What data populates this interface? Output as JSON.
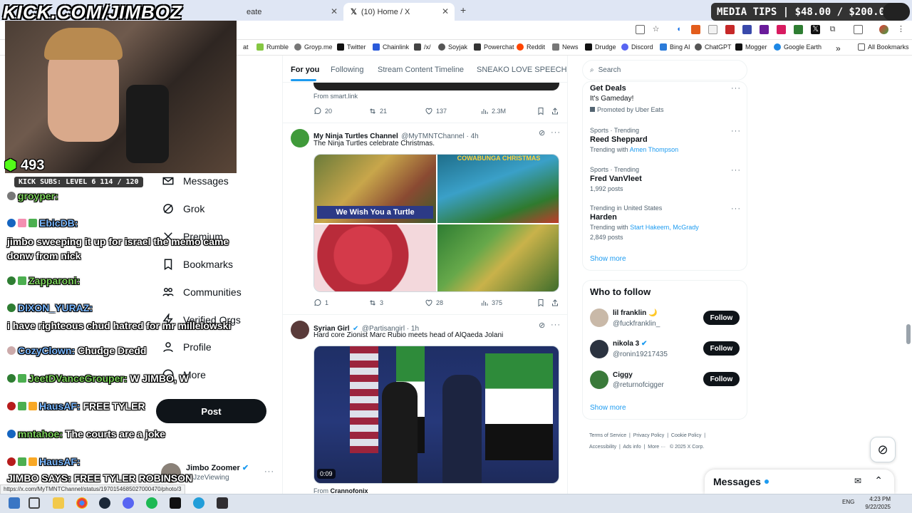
{
  "overlay": {
    "title_banner": "KICK.COM/JIMBOZ",
    "media_tips": "MEDIA TIPS | $48.00 / $200.00",
    "viewer_count": "493",
    "kick_subs": "KICK SUBS: LEVEL 6 114 / 120",
    "chat": [
      {
        "user": "groyper:",
        "msg": ""
      },
      {
        "user": "EbicDB:",
        "msg": "jimbo sweeping it up for israel the memo came donw from nick"
      },
      {
        "user": "Zapparoni:",
        "msg": ""
      },
      {
        "user": "DIXON_YURAZ:",
        "msg": "i have righteous chud hatred for mr millelowski"
      },
      {
        "user": "CozyClown:",
        "msg": "Chudge Dredd"
      },
      {
        "user": "JeetDVanceGrouper:",
        "msg": "W JIMBO, W"
      },
      {
        "user": "HausAF:",
        "msg": "FREE TYLER"
      },
      {
        "user": "mntahoe:",
        "msg": "The courts are a joke"
      },
      {
        "user": "HausAF:",
        "msg": "JIMBO SAYS: FREE TYLER ROBINSON"
      }
    ]
  },
  "browser": {
    "tabs": [
      {
        "label": "eate"
      },
      {
        "label": "(10) Home / X"
      }
    ],
    "new_tab": "+",
    "bookmarks": [
      "at",
      "Rumble",
      "Groyp.me",
      "Twitter",
      "Chainlink",
      "/x/",
      "Soyjak",
      "Powerchat",
      "Reddit",
      "News",
      "Drudge",
      "Discord",
      "Bing AI",
      "ChatGPT",
      "Mogger",
      "Google Earth"
    ],
    "more_bookmarks": "»",
    "all_bookmarks": "All Bookmarks",
    "status_url": "https://x.com/MyTMNTChannel/status/1970154685027000470/photo/3"
  },
  "nav": {
    "items": [
      "Messages",
      "Grok",
      "Premium",
      "Bookmarks",
      "Communities",
      "Verified Orgs",
      "Profile",
      "More"
    ],
    "post_button": "Post",
    "account_name": "Jimbo Zoomer",
    "account_handle": "@JzeViewing"
  },
  "feed": {
    "tabs": [
      "For you",
      "Following",
      "Stream Content Timeline",
      "SNEAKO LOVE SPEECH"
    ],
    "prev_tweet": {
      "source": "From smart.link",
      "replies": "20",
      "reposts": "21",
      "likes": "137",
      "views": "2.3M"
    },
    "tweet1": {
      "name": "My Ninja Turtles Channel",
      "handle": "@MyTMNTChannel · 4h",
      "text": "The Ninja Turtles celebrate Christmas.",
      "image_caption": "We Wish You a Turtle",
      "comic_title": "COWABUNGA CHRISTMAS",
      "replies": "1",
      "reposts": "3",
      "likes": "28",
      "views": "375"
    },
    "tweet2": {
      "name": "Syrian Girl",
      "handle": "@Partisangirl · 1h",
      "text": "Hard core Zionist Marc Rubio meets head of AlQaeda Jolani",
      "video_time": "0:09",
      "source_prefix": "From",
      "source": "Crannofonix"
    }
  },
  "sidebar": {
    "search_placeholder": "Search",
    "promo": {
      "title": "Get Deals",
      "sub": "It's Gameday!",
      "promoted": "Promoted by Uber Eats"
    },
    "trends": [
      {
        "meta": "Sports · Trending",
        "name": "Reed Sheppard",
        "sub_prefix": "Trending with",
        "sub_links": "Amen Thompson"
      },
      {
        "meta": "Sports · Trending",
        "name": "Fred VanVleet",
        "sub_prefix": "1,992 posts",
        "sub_links": ""
      },
      {
        "meta": "Trending in United States",
        "name": "Harden",
        "sub_prefix": "Trending with",
        "sub_links": "Start Hakeem, McGrady",
        "posts": "2,849 posts"
      }
    ],
    "show_more": "Show more",
    "who_to_follow": "Who to follow",
    "follow_suggestions": [
      {
        "name": "lil franklin",
        "emoji": "🌙",
        "handle": "@fuckfranklin_"
      },
      {
        "name": "nikola 3",
        "handle": "@ronin19217435"
      },
      {
        "name": "Ciggy",
        "handle": "@returnofcigger"
      }
    ],
    "follow_label": "Follow",
    "footer": [
      "Terms of Service",
      "Privacy Policy",
      "Cookie Policy",
      "Accessibility",
      "Ads info",
      "More ···",
      "© 2025 X Corp."
    ],
    "messages_drawer": "Messages"
  },
  "taskbar": {
    "time": "4:23 PM",
    "date": "9/22/2025",
    "lang": "ENG"
  }
}
